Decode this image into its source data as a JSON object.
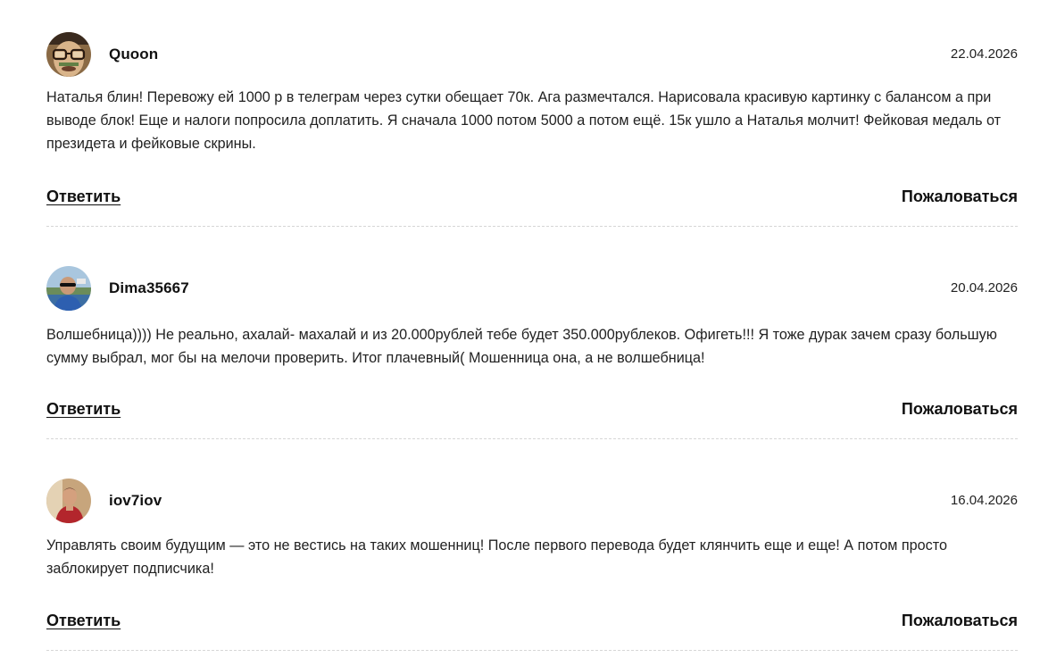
{
  "comments": [
    {
      "username": "Quoon",
      "date": "22.04.2026",
      "text": "Наталья блин! Перевожу ей 1000 р в телеграм через сутки обещает 70к. Ага размечтался. Нарисовала красивую картинку с балансом а при выводе блок! Еще и налоги попросила доплатить. Я сначала 1000 потом 5000 а потом ещё. 15к ушло а Наталья молчит! Фейковая медаль от президета и фейковые скрины.",
      "reply_label": "Ответить",
      "report_label": "Пожаловаться"
    },
    {
      "username": "Dima35667",
      "date": "20.04.2026",
      "text": "Волшебница)))) Не реально, ахалай- махалай и из 20.000рублей тебе будет 350.000рублеков. Офигеть!!! Я тоже дурак зачем сразу большую сумму выбрал, мог бы на мелочи проверить. Итог плачевный( Мошенница она, а не волшебница!",
      "reply_label": "Ответить",
      "report_label": "Пожаловаться"
    },
    {
      "username": "iov7iov",
      "date": "16.04.2026",
      "text": "Управлять своим будущим — это не вестись на таких мошенниц! После первого перевода будет клянчить еще и еще! А потом просто заблокирует подписчика!",
      "reply_label": "Ответить",
      "report_label": "Пожаловаться"
    }
  ]
}
